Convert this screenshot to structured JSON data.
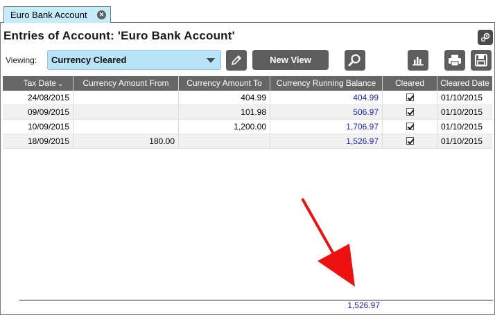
{
  "tab": {
    "label": "Euro Bank Account",
    "close_glyph": "✕"
  },
  "title": "Entries of Account:  'Euro Bank Account'",
  "toolbar": {
    "viewing_label": "Viewing:",
    "view_value": "Currency Cleared",
    "new_view_label": "New View",
    "icons": {
      "settings": "gear-icon",
      "edit": "pencil-icon",
      "search": "magnifier-icon",
      "chart": "bar-chart-icon",
      "print": "printer-icon",
      "save": "floppy-disk-icon"
    }
  },
  "table": {
    "columns": [
      "Tax Date",
      "Currency Amount From",
      "Currency Amount To",
      "Currency Running Balance",
      "Cleared",
      "Cleared Date"
    ],
    "sort_column": "Tax Date",
    "rows": [
      {
        "tax_date": "24/08/2015",
        "amount_from": "",
        "amount_to": "404.99",
        "balance": "404.99",
        "cleared": true,
        "cleared_date": "01/10/2015"
      },
      {
        "tax_date": "09/09/2015",
        "amount_from": "",
        "amount_to": "101.98",
        "balance": "506.97",
        "cleared": true,
        "cleared_date": "01/10/2015"
      },
      {
        "tax_date": "10/09/2015",
        "amount_from": "",
        "amount_to": "1,200.00",
        "balance": "1,706.97",
        "cleared": true,
        "cleared_date": "01/10/2015"
      },
      {
        "tax_date": "18/09/2015",
        "amount_from": "180.00",
        "amount_to": "",
        "balance": "1,526.97",
        "cleared": true,
        "cleared_date": "01/10/2015"
      }
    ],
    "footer_total": "1,526.97"
  },
  "colors": {
    "tab_bg": "#c5ecfb",
    "select_bg": "#b9e4f7",
    "header_bg": "#666666",
    "balance_text": "#1c1fb8",
    "arrow": "#ee1111"
  }
}
